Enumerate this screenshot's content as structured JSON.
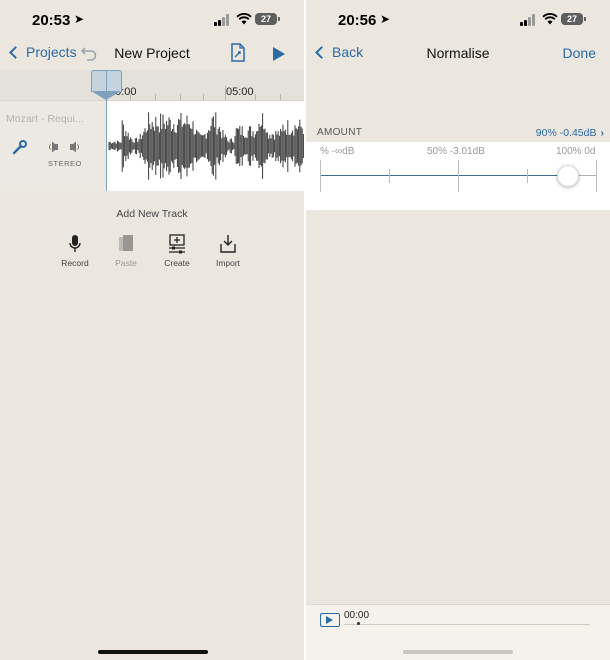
{
  "left": {
    "status": {
      "time": "20:53",
      "battery": "27"
    },
    "nav": {
      "back_label": "Projects",
      "title": "New Project"
    },
    "timeline": {
      "label_start": "00:00",
      "label_mid": "05:00"
    },
    "track": {
      "name": "Mozart - Requi...",
      "mode_label": "STEREO"
    },
    "add_track": {
      "title": "Add New Track",
      "tools": [
        {
          "label": "Record",
          "enabled": true
        },
        {
          "label": "Paste",
          "enabled": false
        },
        {
          "label": "Create",
          "enabled": true
        },
        {
          "label": "Import",
          "enabled": true
        }
      ]
    }
  },
  "right": {
    "status": {
      "time": "20:56",
      "battery": "27"
    },
    "nav": {
      "back_label": "Back",
      "title": "Normalise",
      "done_label": "Done"
    },
    "amount": {
      "label": "AMOUNT",
      "value": "90% -0.45dB",
      "level_percent": 90,
      "min_label": "% -∞dB",
      "mid_label": "50% -3.01dB",
      "max_label": "100% 0d"
    },
    "player": {
      "time": "00:00"
    }
  },
  "colors": {
    "accent": "#2c6aa6",
    "background": "#ebe7df",
    "waveform": "#3a3a3a"
  }
}
